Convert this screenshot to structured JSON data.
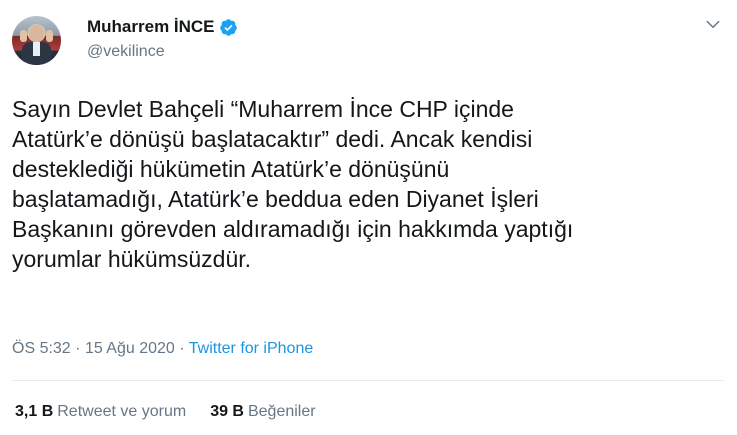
{
  "author": {
    "display_name": "Muharrem İNCE",
    "handle": "@vekilince",
    "verified": true
  },
  "tweet": {
    "text": "Sayın Devlet Bahçeli “Muharrem İnce CHP içinde\nAtatürk’e dönüşü başlatacaktır” dedi. Ancak kendisi\ndesteklediği hükümetin Atatürk’e dönüşünü\nbaşlatamadığı, Atatürk’e beddua eden Diyanet İşleri\nBaşkanını görevden aldıramadığı için hakkımda yaptığı\nyorumlar hükümsüzdür."
  },
  "meta": {
    "time": "ÖS 5:32",
    "separator": "·",
    "date": "15 Ağu 2020",
    "source": "Twitter for iPhone"
  },
  "stats": {
    "retweets_count": "3,1 B",
    "retweets_label": "Retweet ve yorum",
    "likes_count": "39 B",
    "likes_label": "Beğeniler"
  },
  "icons": {
    "verified": "verified-badge-icon",
    "more": "chevron-down-icon"
  },
  "colors": {
    "text": "#14171a",
    "secondary": "#657786",
    "link": "#1b95e0",
    "verified": "#1da1f2",
    "divider": "#e6ecf0"
  }
}
